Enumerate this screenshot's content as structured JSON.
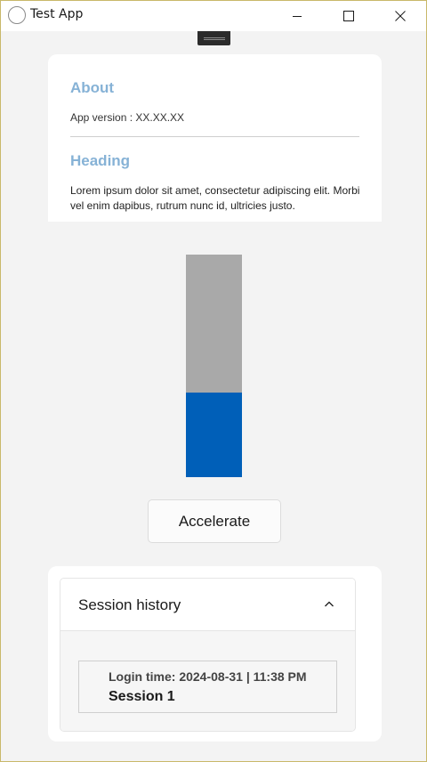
{
  "window": {
    "title": "Test App"
  },
  "about": {
    "title": "About",
    "version": "App version : XX.XX.XX",
    "heading": "Heading",
    "body": "Lorem ipsum dolor sit amet, consectetur adipiscing elit. Morbi vel enim dapibus, rutrum nunc id, ultricies justo."
  },
  "meter": {
    "fill_fraction": 0.38,
    "fill_color": "#005fb8",
    "track_color": "#a9a9a9"
  },
  "actions": {
    "accelerate_label": "Accelerate"
  },
  "session_history": {
    "title": "Session history",
    "expanded": true,
    "items": [
      {
        "login_time": "Login time: 2024-08-31 | 11:38 PM",
        "name": "Session 1"
      }
    ]
  },
  "colors": {
    "accent": "#005fb8",
    "heading": "#86b2d6"
  }
}
